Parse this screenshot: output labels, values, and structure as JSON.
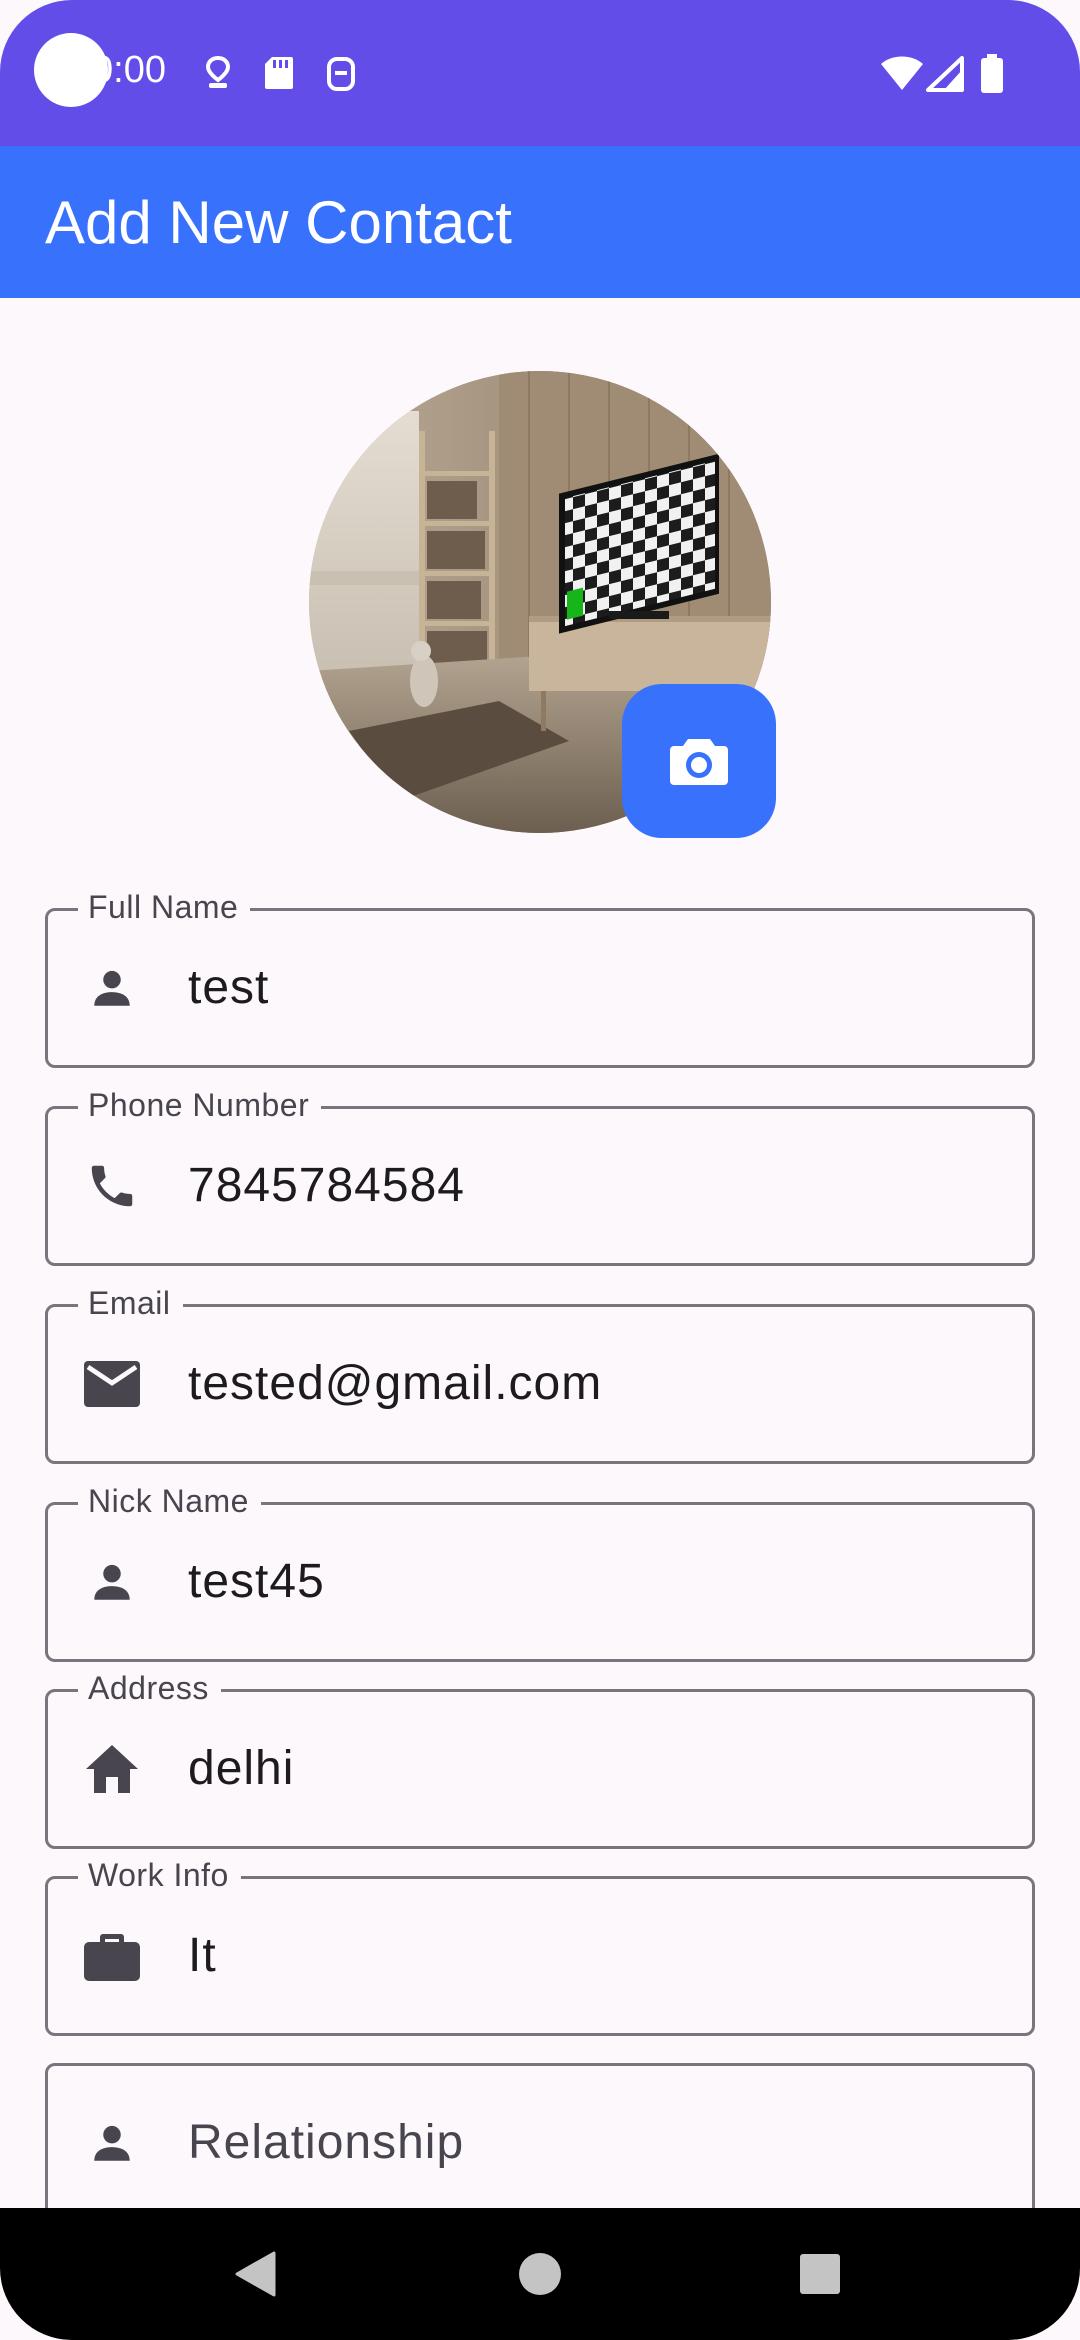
{
  "status_bar": {
    "time": "0:00",
    "background": "#624de9"
  },
  "app_bar": {
    "title": "Add New Contact",
    "background": "#3871fc"
  },
  "avatar": {
    "camera_icon": "camera-icon"
  },
  "fields": [
    {
      "label": "Full Name",
      "value": "test",
      "icon": "person-icon"
    },
    {
      "label": "Phone Number",
      "value": "7845784584",
      "icon": "phone-icon"
    },
    {
      "label": "Email",
      "value": "tested@gmail.com",
      "icon": "email-icon"
    },
    {
      "label": "Nick Name",
      "value": "test45",
      "icon": "person-icon"
    },
    {
      "label": "Address",
      "value": "delhi",
      "icon": "home-icon"
    },
    {
      "label": "Work Info",
      "value": "It",
      "icon": "briefcase-icon"
    },
    {
      "placeholder": "Relationship",
      "icon": "person-icon"
    }
  ],
  "nav_bar": {
    "back_icon": "back-triangle-icon",
    "home_icon": "home-circle-icon",
    "recents_icon": "recents-square-icon"
  }
}
